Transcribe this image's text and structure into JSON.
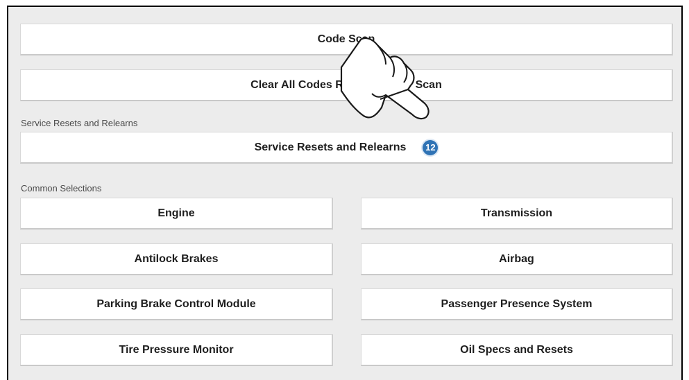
{
  "primary": {
    "code_scan": "Code Scan",
    "clear_all_codes": "Clear All Codes Rea",
    "clear_all_codes_tail": "Scan"
  },
  "service": {
    "section_label": "Service Resets and Relearns",
    "button_label": "Service Resets and Relearns",
    "badge": "12"
  },
  "common": {
    "section_label": "Common Selections",
    "items": [
      {
        "label": "Engine"
      },
      {
        "label": "Transmission"
      },
      {
        "label": "Antilock Brakes"
      },
      {
        "label": "Airbag"
      },
      {
        "label": "Parking Brake Control Module"
      },
      {
        "label": "Passenger Presence System"
      },
      {
        "label": "Tire Pressure Monitor"
      },
      {
        "label": "Oil Specs and Resets"
      }
    ]
  },
  "overlay": {
    "icon": "pointing-hand-icon",
    "badge_color": "#2f73b5"
  }
}
